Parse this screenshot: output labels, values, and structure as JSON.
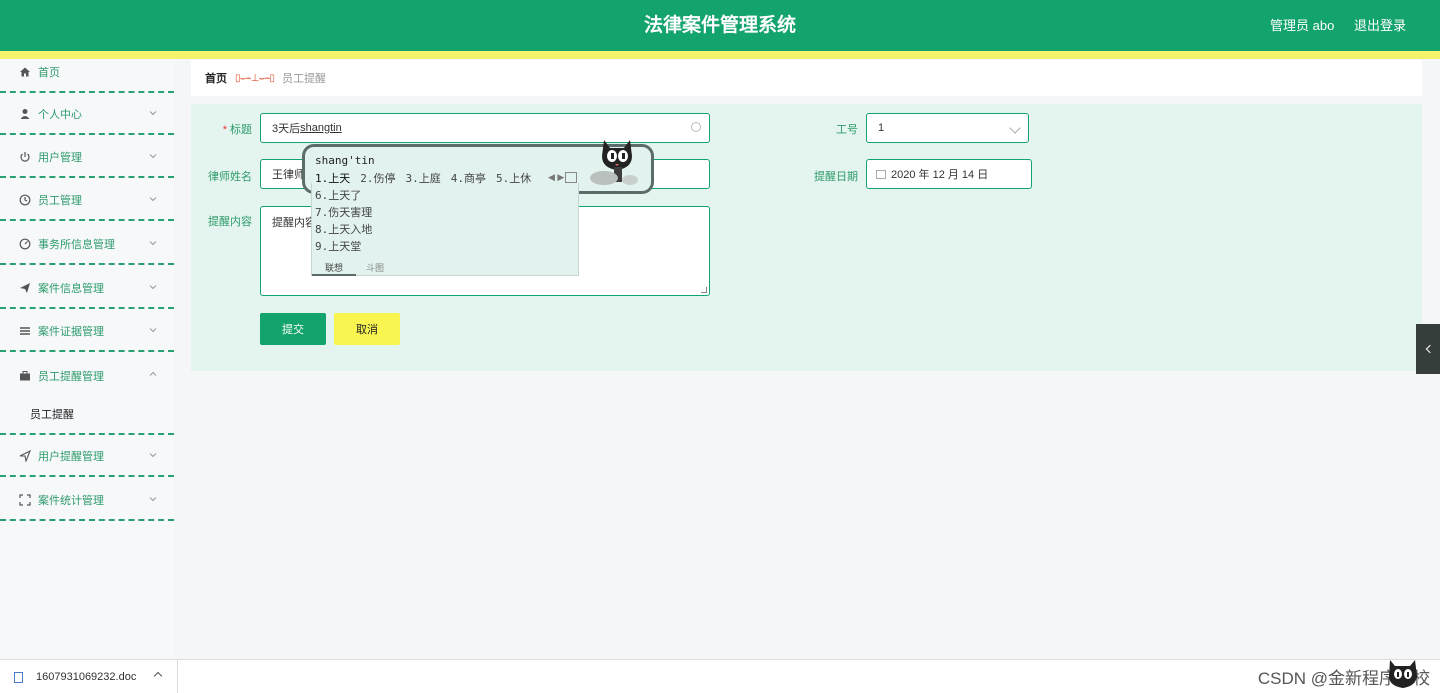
{
  "header": {
    "title": "法律案件管理系统",
    "user_label": "管理员 abo",
    "logout_label": "退出登录"
  },
  "sidebar": {
    "items": [
      {
        "label": "首页",
        "icon": "home-icon"
      },
      {
        "label": "个人中心",
        "icon": "user-icon"
      },
      {
        "label": "用户管理",
        "icon": "power-icon"
      },
      {
        "label": "员工管理",
        "icon": "clock-icon"
      },
      {
        "label": "事务所信息管理",
        "icon": "gauge-icon"
      },
      {
        "label": "案件信息管理",
        "icon": "send-icon"
      },
      {
        "label": "案件证据管理",
        "icon": "list-icon"
      },
      {
        "label": "员工提醒管理",
        "icon": "briefcase-icon"
      },
      {
        "label": "用户提醒管理",
        "icon": "navigation-icon"
      },
      {
        "label": "案件统计管理",
        "icon": "expand-icon"
      }
    ],
    "active_sub": "员工提醒"
  },
  "breadcrumb": {
    "home": "首页",
    "current": "员工提醒"
  },
  "form": {
    "title_label": "标题",
    "title_value_prefix": "3天后",
    "title_value_composing": "shangtin",
    "job_no_label": "工号",
    "job_no_value": "1",
    "lawyer_label": "律师姓名",
    "lawyer_value": "王律师",
    "date_label": "提醒日期",
    "date_value": "2020 年 12 月 14 日",
    "content_label": "提醒内容",
    "content_value": "提醒内容",
    "submit_label": "提交",
    "cancel_label": "取消"
  },
  "ime": {
    "pinyin": "shang'tin",
    "row1": [
      "1.上天",
      "2.伤停",
      "3.上庭",
      "4.商亭",
      "5.上休"
    ],
    "candidates": [
      "6.上天了",
      "7.伤天害理",
      "8.上天入地",
      "9.上天堂"
    ],
    "tab_active": "联想",
    "tab_other": "斗图"
  },
  "downloads": {
    "filename": "1607931069232.doc"
  },
  "watermark": "CSDN @金新程序学校",
  "colors": {
    "primary": "#13a36d",
    "accent_yellow": "#f8f550",
    "panel_bg": "#e4f4ee"
  }
}
